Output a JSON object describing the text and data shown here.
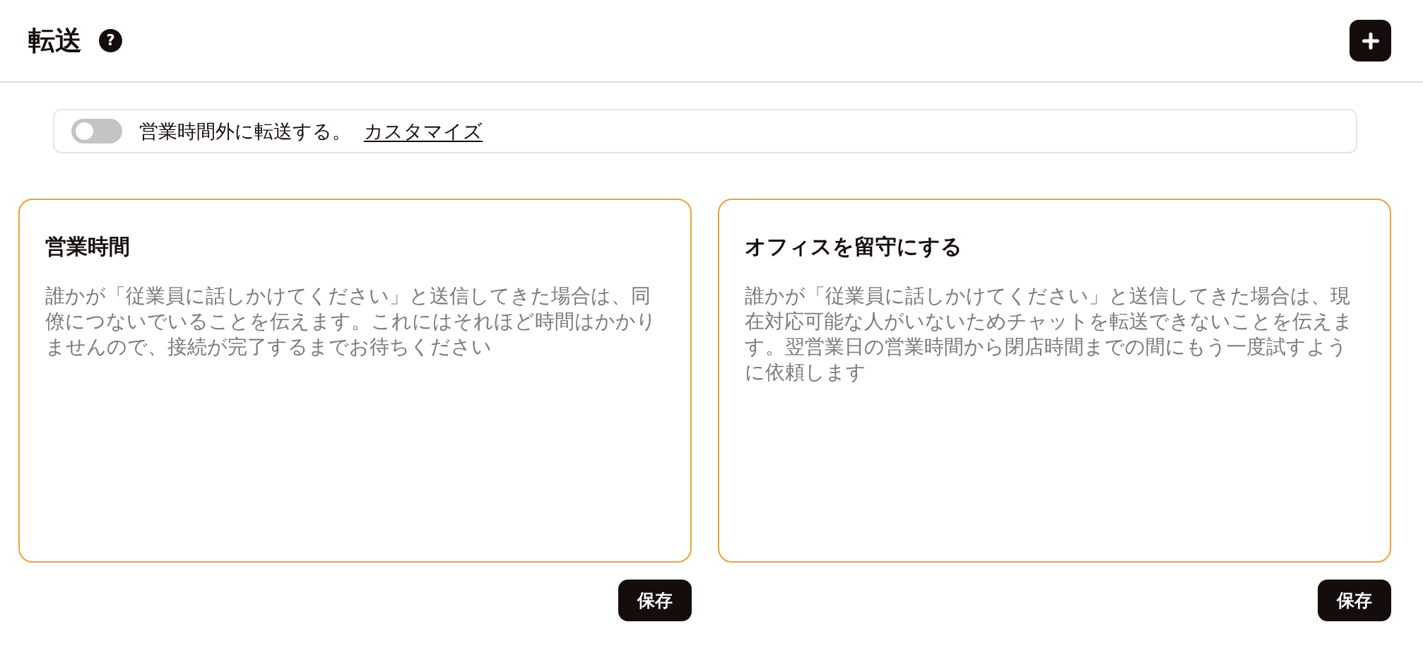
{
  "header": {
    "title": "転送",
    "help_glyph": "?"
  },
  "after_hours": {
    "on": false,
    "label": "営業時間外に転送する。",
    "link": "カスタマイズ"
  },
  "cards": [
    {
      "title": "営業時間",
      "message": "誰かが「従業員に話しかけてください」と送信してきた場合は、同僚につないでいることを伝えます。これにはそれほど時間はかかりませんので、接続が完了するまでお待ちください",
      "button": "保存"
    },
    {
      "title": "オフィスを留守にする",
      "message": "誰かが「従業員に話しかけてください」と送信してきた場合は、現在対応可能な人がいないためチャットを転送できないことを伝えます。翌営業日の営業時間から閉店時間までの間にもう一度試すように依頼します",
      "button": "保存"
    }
  ]
}
